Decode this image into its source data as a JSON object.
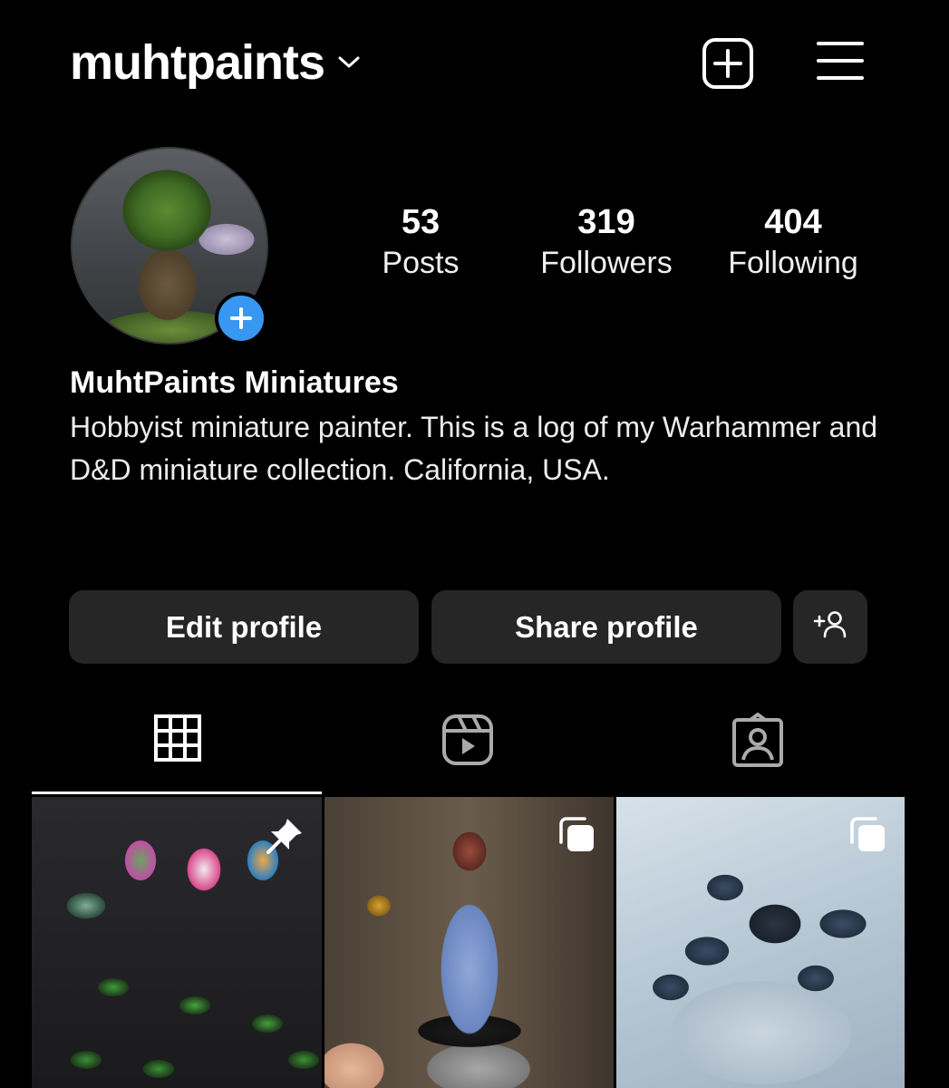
{
  "header": {
    "username": "muhtpaints"
  },
  "profile": {
    "stats": [
      {
        "value": "53",
        "label": "Posts"
      },
      {
        "value": "319",
        "label": "Followers"
      },
      {
        "value": "404",
        "label": "Following"
      }
    ],
    "display_name": "MuhtPaints Miniatures",
    "bio": "Hobbyist miniature painter. This is a log of my Warhammer and D&D miniature collection. California, USA."
  },
  "actions": {
    "edit_label": "Edit profile",
    "share_label": "Share profile"
  },
  "tabs": [
    {
      "icon": "grid-icon",
      "active": true
    },
    {
      "icon": "reels-icon",
      "active": false
    },
    {
      "icon": "tagged-icon",
      "active": false
    }
  ],
  "posts": [
    {
      "badge": "pin-icon"
    },
    {
      "badge": "carousel-icon"
    },
    {
      "badge": "carousel-icon"
    }
  ],
  "colors": {
    "background": "#000000",
    "button_bg": "#262626",
    "accent_blue": "#3897f0",
    "text": "#ffffff"
  }
}
